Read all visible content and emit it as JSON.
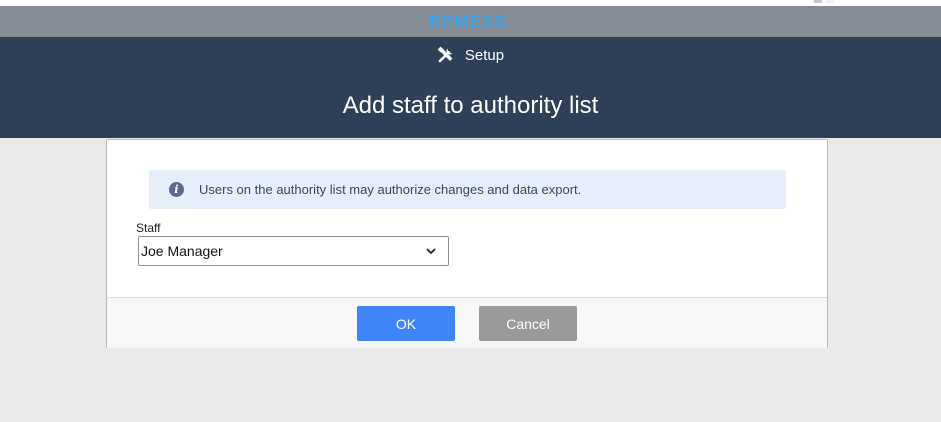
{
  "brand": {
    "logo_text": "RPMESS",
    "logo_color": "#3aa3e8"
  },
  "header": {
    "section_label": "Setup",
    "section_icon": "tools-icon",
    "title": "Add staff to authority list"
  },
  "dialog": {
    "info_icon": "info-icon",
    "info_text": "Users on the authority list may authorize changes and data export.",
    "staff_label": "Staff",
    "staff_value": "Joe Manager",
    "ok_label": "OK",
    "cancel_label": "Cancel"
  },
  "colors": {
    "header_bg": "#2e4058",
    "top_bar_bg": "#858c96",
    "ok_button": "#3f84f8",
    "cancel_button": "#9a9a9a",
    "info_bg": "#e7eefb"
  }
}
